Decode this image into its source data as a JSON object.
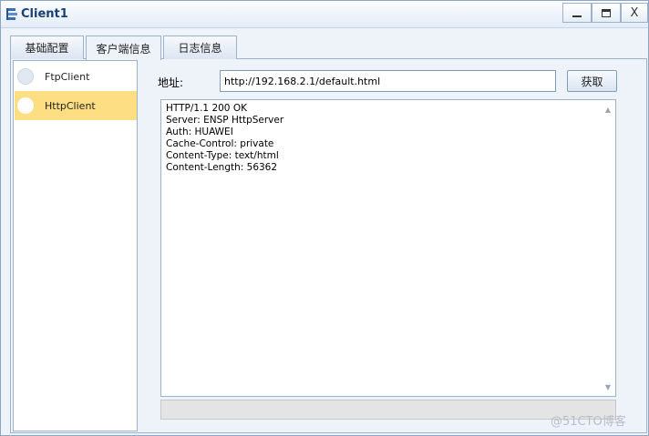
{
  "window": {
    "title": "Client1",
    "controls": {
      "minimize": "minimize",
      "maximize": "maximize",
      "close": "X"
    }
  },
  "tabs": [
    {
      "label": "基础配置",
      "active": false
    },
    {
      "label": "客户端信息",
      "active": true
    },
    {
      "label": "日志信息",
      "active": false
    }
  ],
  "clients": [
    {
      "label": "FtpClient",
      "selected": false
    },
    {
      "label": "HttpClient",
      "selected": true
    }
  ],
  "address": {
    "label": "地址:",
    "value": "http://192.168.2.1/default.html",
    "button_label": "获取"
  },
  "response": {
    "lines": [
      "HTTP/1.1 200 OK",
      "Server: ENSP HttpServer",
      "Auth: HUAWEI",
      "Cache-Control: private",
      "Content-Type: text/html",
      "Content-Length: 56362"
    ]
  },
  "watermark": "@51CTO博客",
  "colors": {
    "selected_row": "#fede82",
    "title_text": "#1a3f73",
    "border": "#9fb2cc"
  }
}
